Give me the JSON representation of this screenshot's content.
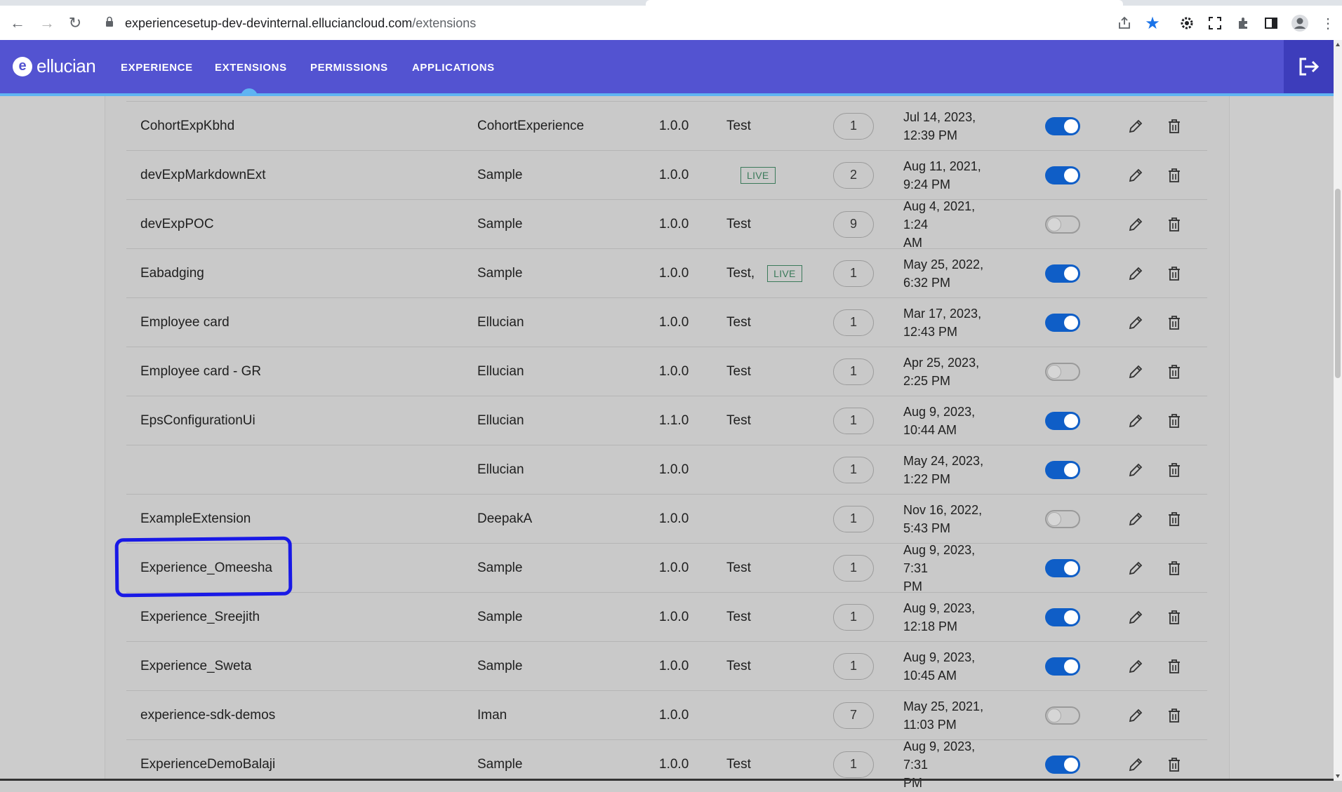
{
  "browser": {
    "url_host": "experiencesetup-dev-devinternal.elluciancloud.com",
    "url_path": "/extensions"
  },
  "app": {
    "brand": "ellucian",
    "nav": [
      {
        "label": "EXPERIENCE",
        "active": false
      },
      {
        "label": "EXTENSIONS",
        "active": true
      },
      {
        "label": "PERMISSIONS",
        "active": false
      },
      {
        "label": "APPLICATIONS",
        "active": false
      }
    ],
    "accent_color": "#5353d1",
    "indicator_color": "#5fb4f2",
    "toggle_on_color": "#0f5ec7"
  },
  "table": {
    "rows": [
      {
        "name": "CohortExpKbhd",
        "owner": "CohortExperience",
        "version": "1.0.0",
        "env": "Test",
        "live": false,
        "count": "1",
        "date_line1": "Jul 14, 2023,",
        "date_line2": "12:39 PM",
        "enabled": true
      },
      {
        "name": "devExpMarkdownExt",
        "owner": "Sample",
        "version": "1.0.0",
        "env": "",
        "live": true,
        "count": "2",
        "date_line1": "Aug 11, 2021,",
        "date_line2": "9:24 PM",
        "enabled": true
      },
      {
        "name": "devExpPOC",
        "owner": "Sample",
        "version": "1.0.0",
        "env": "Test",
        "live": false,
        "count": "9",
        "date_line1": "Aug 4, 2021, 1:24",
        "date_line2": "AM",
        "enabled": false
      },
      {
        "name": "Eabadging",
        "owner": "Sample",
        "version": "1.0.0",
        "env": "Test,",
        "live": true,
        "count": "1",
        "date_line1": "May 25, 2022,",
        "date_line2": "6:32 PM",
        "enabled": true
      },
      {
        "name": "Employee card",
        "owner": "Ellucian",
        "version": "1.0.0",
        "env": "Test",
        "live": false,
        "count": "1",
        "date_line1": "Mar 17, 2023,",
        "date_line2": "12:43 PM",
        "enabled": true
      },
      {
        "name": "Employee card - GR",
        "owner": "Ellucian",
        "version": "1.0.0",
        "env": "Test",
        "live": false,
        "count": "1",
        "date_line1": "Apr 25, 2023,",
        "date_line2": "2:25 PM",
        "enabled": false
      },
      {
        "name": "EpsConfigurationUi",
        "owner": "Ellucian",
        "version": "1.1.0",
        "env": "Test",
        "live": false,
        "count": "1",
        "date_line1": "Aug 9, 2023,",
        "date_line2": "10:44 AM",
        "enabled": true
      },
      {
        "name": "",
        "owner": "Ellucian",
        "version": "1.0.0",
        "env": "",
        "live": false,
        "count": "1",
        "date_line1": "May 24, 2023,",
        "date_line2": "1:22 PM",
        "enabled": true
      },
      {
        "name": "ExampleExtension",
        "owner": "DeepakA",
        "version": "1.0.0",
        "env": "",
        "live": false,
        "count": "1",
        "date_line1": "Nov 16, 2022,",
        "date_line2": "5:43 PM",
        "enabled": false
      },
      {
        "name": "Experience_Omeesha",
        "owner": "Sample",
        "version": "1.0.0",
        "env": "Test",
        "live": false,
        "count": "1",
        "date_line1": "Aug 9, 2023, 7:31",
        "date_line2": "PM",
        "enabled": true
      },
      {
        "name": "Experience_Sreejith",
        "owner": "Sample",
        "version": "1.0.0",
        "env": "Test",
        "live": false,
        "count": "1",
        "date_line1": "Aug 9, 2023,",
        "date_line2": "12:18 PM",
        "enabled": true
      },
      {
        "name": "Experience_Sweta",
        "owner": "Sample",
        "version": "1.0.0",
        "env": "Test",
        "live": false,
        "count": "1",
        "date_line1": "Aug 9, 2023,",
        "date_line2": "10:45 AM",
        "enabled": true
      },
      {
        "name": "experience-sdk-demos",
        "owner": "Iman",
        "version": "1.0.0",
        "env": "",
        "live": false,
        "count": "7",
        "date_line1": "May 25, 2021,",
        "date_line2": "11:03 PM",
        "enabled": false
      },
      {
        "name": "ExperienceDemoBalaji",
        "owner": "Sample",
        "version": "1.0.0",
        "env": "Test",
        "live": false,
        "count": "1",
        "date_line1": "Aug 9, 2023, 7:31",
        "date_line2": "PM",
        "enabled": true
      }
    ],
    "live_label": "LIVE"
  }
}
